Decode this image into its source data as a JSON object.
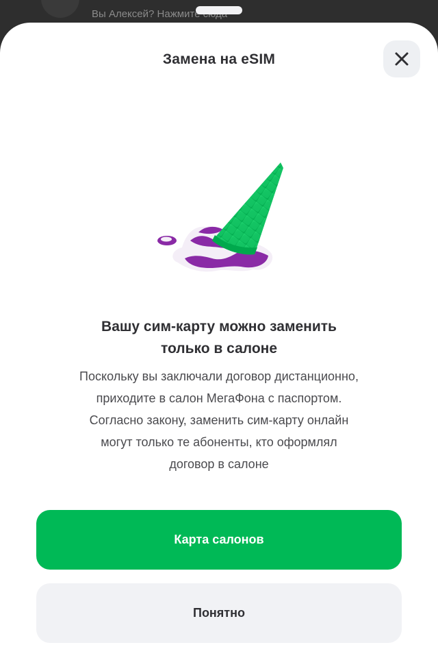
{
  "background": {
    "hint_text": "Вы Алексей? Нажмите сюда"
  },
  "sheet": {
    "title": "Замена на eSIM",
    "close_icon": "close-icon",
    "illustration": "melted-ice-cream-illustration",
    "headline_lines": [
      "Вашу сим-карту можно заменить",
      "только в салоне"
    ],
    "body_lines": [
      "Поскольку вы заключали договор дистанционно,",
      "приходите в салон МегаФона с паспортом.",
      "Согласно закону, заменить сим-карту онлайн",
      "могут только те абоненты, кто оформлял",
      "договор в салоне"
    ],
    "primary_button": "Карта салонов",
    "secondary_button": "Понятно"
  },
  "colors": {
    "accent_green": "#00b956",
    "accent_purple": "#8a2aa6",
    "text_primary": "#2f2f33",
    "secondary_button_bg": "#f1f2f5",
    "close_button_bg": "#eef0f3"
  }
}
